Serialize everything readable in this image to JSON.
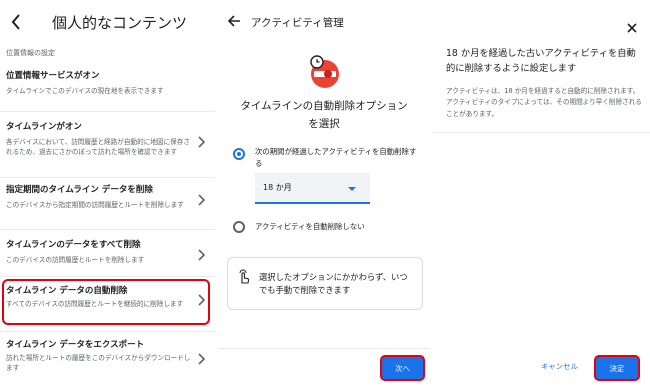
{
  "panel1": {
    "title": "個人的なコンテンツ",
    "section_label": "位置情報の設定",
    "items": [
      {
        "title": "位置情報サービスがオン",
        "subtitle": "タイムラインでこのデバイスの現在地を表示できます",
        "has_chevron": false
      },
      {
        "title": "タイムラインがオン",
        "subtitle": "各デバイスにおいて、訪問履歴と経路が自動的に地図に保存されるため、過去にさかのぼって訪れた場所を確認できます",
        "has_chevron": true
      },
      {
        "title": "指定期間のタイムライン データを削除",
        "subtitle": "このデバイスから指定期間の訪問履歴とルートを削除します",
        "has_chevron": true
      },
      {
        "title": "タイムラインのデータをすべて削除",
        "subtitle": "このデバイスの訪問履歴とルートを削除します",
        "has_chevron": true
      },
      {
        "title": "タイムライン データの自動削除",
        "subtitle": "すべてのデバイスの訪問履歴とルートを継続的に削除します",
        "has_chevron": true,
        "highlighted": true
      },
      {
        "title": "タイムライン データをエクスポート",
        "subtitle": "訪れた場所とルートの履歴をこのデバイスからダウンロードします",
        "has_chevron": true
      }
    ]
  },
  "panel2": {
    "title": "アクティビティ管理",
    "heading": "タイムラインの自動削除オプションを選択",
    "option1_label": "次の期間が経過したアクティビティを自動削除する",
    "select_value": "18 か月",
    "option2_label": "アクティビティを自動削除しない",
    "info_text": "選択したオプションにかかわらず、いつでも手動で削除できます",
    "next_button": "次へ",
    "selected_option": 1
  },
  "panel3": {
    "title": "18 か月を経過した古いアクティビティを自動的に削除するように設定します",
    "body": "アクティビティは、18 か月を経過すると自動的に削除されます。アクティビティのタイプによっては、その期間より早く削除されることがあります。",
    "cancel_button": "キャンセル",
    "confirm_button": "決定"
  },
  "colors": {
    "accent": "#1a73e8",
    "highlight": "#e3000f",
    "icon_red": "#ea4335"
  },
  "icons": {
    "back": "chevron-left-icon",
    "back_arrow": "arrow-left-icon",
    "chevron": "chevron-right-icon",
    "activity": "activity-clock-icon",
    "hand": "hand-tap-icon",
    "close": "close-icon"
  }
}
